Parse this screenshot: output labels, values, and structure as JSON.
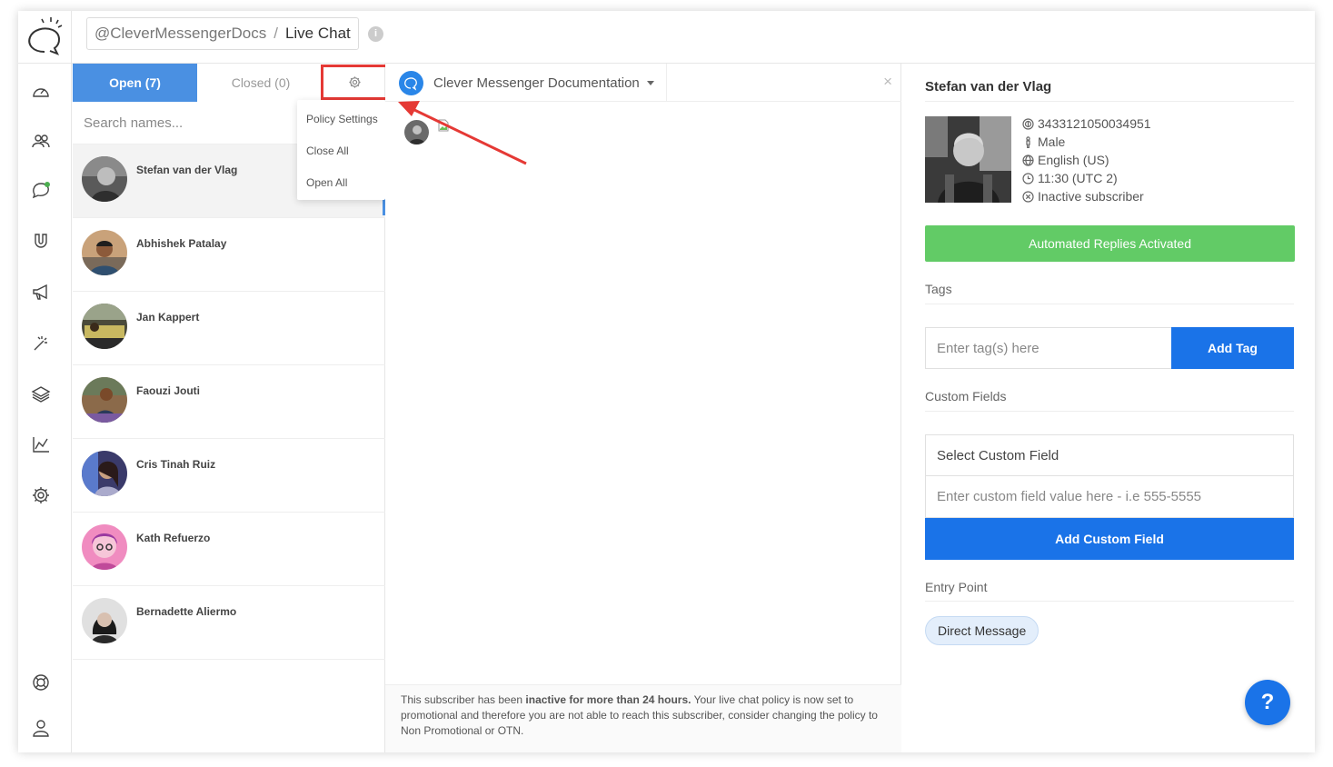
{
  "header": {
    "account": "@CleverMessengerDocs",
    "separator": "/",
    "page": "Live Chat"
  },
  "sidebar": {
    "items": [
      {
        "icon": "dashboard-icon"
      },
      {
        "icon": "users-icon"
      },
      {
        "icon": "chat-bubble-icon"
      },
      {
        "icon": "magnet-icon"
      },
      {
        "icon": "megaphone-icon"
      },
      {
        "icon": "magic-wand-icon"
      },
      {
        "icon": "layers-icon"
      },
      {
        "icon": "analytics-chart-icon"
      },
      {
        "icon": "settings-gear-icon"
      }
    ],
    "bottom": [
      {
        "icon": "lifebuoy-icon"
      },
      {
        "icon": "user-profile-icon"
      }
    ]
  },
  "list": {
    "tab_open": "Open (7)",
    "tab_closed": "Closed (0)",
    "search_placeholder": "Search names...",
    "conversations": [
      {
        "name": "Stefan van der Vlag",
        "selected": true
      },
      {
        "name": "Abhishek Patalay"
      },
      {
        "name": "Jan Kappert"
      },
      {
        "name": "Faouzi Jouti"
      },
      {
        "name": "Cris Tinah Ruiz"
      },
      {
        "name": "Kath Refuerzo"
      },
      {
        "name": "Bernadette Aliermo"
      }
    ]
  },
  "dropdown": {
    "items": [
      "Policy Settings",
      "Close All",
      "Open All"
    ]
  },
  "chat": {
    "page_name": "Clever Messenger Documentation",
    "close_glyph": "×",
    "footer_prefix": "This subscriber has been ",
    "footer_bold": "inactive for more than 24 hours.",
    "footer_suffix": " Your live chat policy is now set to promotional and therefore you are not able to reach this subscriber, consider changing the policy to Non Promotional or OTN."
  },
  "details": {
    "name": "Stefan van der Vlag",
    "id": "3433121050034951",
    "gender": "Male",
    "locale": "English (US)",
    "time": "11:30 (UTC 2)",
    "status": "Inactive subscriber",
    "automated_button": "Automated Replies Activated",
    "tags_title": "Tags",
    "tag_placeholder": "Enter tag(s) here",
    "add_tag": "Add Tag",
    "custom_fields_title": "Custom Fields",
    "custom_field_select": "Select Custom Field",
    "custom_field_placeholder": "Enter custom field value here - i.e 555-5555",
    "add_custom_field": "Add Custom Field",
    "entry_point_title": "Entry Point",
    "entry_point_value": "Direct Message"
  },
  "help_label": "?",
  "colors": {
    "primary": "#1a73e8",
    "tab_active": "#4a90e2",
    "success": "#62cb66",
    "highlight": "#e53935",
    "online_dot": "#4caf50"
  }
}
